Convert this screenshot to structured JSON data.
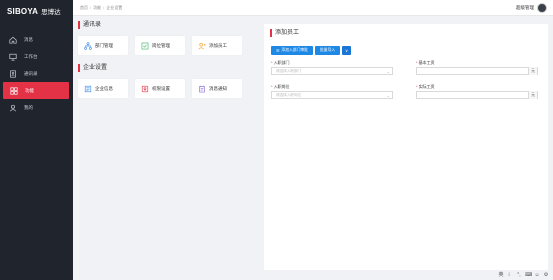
{
  "brand": {
    "logo_text": "SIBOYA",
    "logo_cn": "思博达"
  },
  "sidebar": {
    "items": [
      {
        "label": "消息",
        "icon": "home-icon",
        "active": false
      },
      {
        "label": "工作台",
        "icon": "monitor-icon",
        "active": false
      },
      {
        "label": "通讯录",
        "icon": "contacts-icon",
        "active": false
      },
      {
        "label": "功能",
        "icon": "grid-icon",
        "active": true
      },
      {
        "label": "我的",
        "icon": "user-icon",
        "active": false
      }
    ]
  },
  "breadcrumb": [
    "首页",
    "功能",
    "企业设置"
  ],
  "user": {
    "name": "超级管理"
  },
  "contacts_section": {
    "title": "通讯录",
    "cards": [
      {
        "label": "部门管理",
        "icon": "org-icon"
      },
      {
        "label": "岗位管理",
        "icon": "position-icon"
      },
      {
        "label": "添加员工",
        "icon": "add-user-icon"
      }
    ]
  },
  "company_section": {
    "title": "企业设置",
    "cards": [
      {
        "label": "企业信息",
        "icon": "building-icon"
      },
      {
        "label": "权限设置",
        "icon": "permission-icon"
      },
      {
        "label": "消息通知",
        "icon": "notice-icon"
      }
    ]
  },
  "form": {
    "title": "添加员工",
    "buttons": {
      "add_dept": "添加入部门审批",
      "bulk_import": "批量导入",
      "more": "∨"
    },
    "dept": {
      "label": "入职部门",
      "placeholder": "请选择入职部门"
    },
    "position": {
      "label": "入职岗位",
      "placeholder": "请选择入职岗位"
    },
    "base_salary": {
      "label": "基本工资",
      "unit": "元"
    },
    "probation_salary": {
      "label": "实际工资",
      "unit": "元"
    }
  },
  "colors": {
    "accent": "#e33146",
    "primary_button": "#1e88e5",
    "sidebar_bg": "#20242c"
  }
}
